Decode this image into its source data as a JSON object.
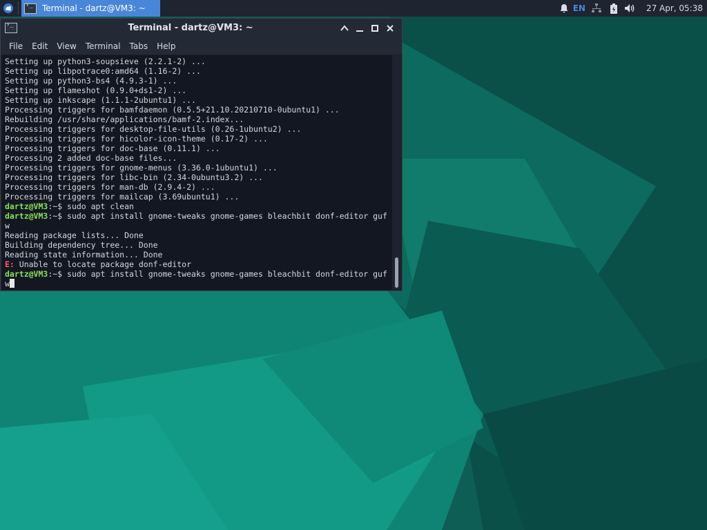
{
  "panel": {
    "task_label": "Terminal - dartz@VM3: ~",
    "lang": "EN",
    "clock": "27 Apr, 05:38",
    "icons": [
      "xfce-launcher-icon",
      "terminal-icon",
      "notification-bell-icon",
      "network-icon",
      "battery-icon",
      "volume-icon"
    ]
  },
  "window": {
    "title": "Terminal - dartz@VM3: ~",
    "menu": [
      "File",
      "Edit",
      "View",
      "Terminal",
      "Tabs",
      "Help"
    ]
  },
  "terminal": {
    "prompt_user": "dartz@VM3",
    "prompt_sep": ":~$ ",
    "lines": [
      {
        "kind": "text",
        "text": "Setting up python3-soupsieve (2.2.1-2) ..."
      },
      {
        "kind": "text",
        "text": "Setting up libpotrace0:amd64 (1.16-2) ..."
      },
      {
        "kind": "text",
        "text": "Setting up python3-bs4 (4.9.3-1) ..."
      },
      {
        "kind": "text",
        "text": "Setting up flameshot (0.9.0+ds1-2) ..."
      },
      {
        "kind": "text",
        "text": "Setting up inkscape (1.1.1-2ubuntu1) ..."
      },
      {
        "kind": "text",
        "text": "Processing triggers for bamfdaemon (0.5.5+21.10.20210710-0ubuntu1) ..."
      },
      {
        "kind": "text",
        "text": "Rebuilding /usr/share/applications/bamf-2.index..."
      },
      {
        "kind": "text",
        "text": "Processing triggers for desktop-file-utils (0.26-1ubuntu2) ..."
      },
      {
        "kind": "text",
        "text": "Processing triggers for hicolor-icon-theme (0.17-2) ..."
      },
      {
        "kind": "text",
        "text": "Processing triggers for doc-base (0.11.1) ..."
      },
      {
        "kind": "text",
        "text": "Processing 2 added doc-base files..."
      },
      {
        "kind": "text",
        "text": "Processing triggers for gnome-menus (3.36.0-1ubuntu1) ..."
      },
      {
        "kind": "text",
        "text": "Processing triggers for libc-bin (2.34-0ubuntu3.2) ..."
      },
      {
        "kind": "text",
        "text": "Processing triggers for man-db (2.9.4-2) ..."
      },
      {
        "kind": "text",
        "text": "Processing triggers for mailcap (3.69ubuntu1) ..."
      },
      {
        "kind": "prompt",
        "text": "sudo apt clean"
      },
      {
        "kind": "prompt",
        "text": "sudo apt install gnome-tweaks gnome-games bleachbit donf-editor guf"
      },
      {
        "kind": "text",
        "text": "w"
      },
      {
        "kind": "text",
        "text": "Reading package lists... Done"
      },
      {
        "kind": "text",
        "text": "Building dependency tree... Done"
      },
      {
        "kind": "text",
        "text": "Reading state information... Done"
      },
      {
        "kind": "error",
        "label": "E:",
        "text": " Unable to locate package donf-editor"
      },
      {
        "kind": "prompt",
        "text": "sudo apt install gnome-tweaks gnome-games bleachbit donf-editor guf"
      },
      {
        "kind": "cursor",
        "text": "w"
      }
    ]
  }
}
